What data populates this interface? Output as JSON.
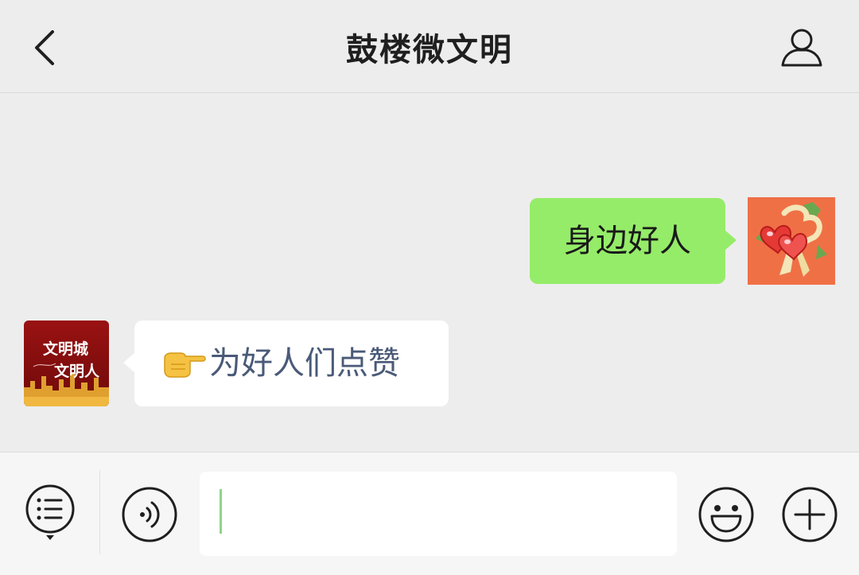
{
  "header": {
    "title": "鼓楼微文明",
    "back_icon": "chevron-left-icon",
    "profile_icon": "person-icon"
  },
  "messages": [
    {
      "sender": "me",
      "text": "身边好人",
      "bubble_color": "#95ec69",
      "avatar_icon": "hearts-bouquet-icon"
    },
    {
      "sender": "other",
      "text": "为好人们点赞",
      "emoji": "pointing-right-emoji",
      "text_color": "#4a5a78",
      "avatar": {
        "line1": "文明城",
        "line2": "文明人",
        "background": "#8a1010"
      }
    }
  ],
  "input_bar": {
    "menu_icon": "list-menu-icon",
    "voice_icon": "voice-icon",
    "text_value": "",
    "emoji_icon": "smiley-icon",
    "more_icon": "plus-circle-icon"
  }
}
